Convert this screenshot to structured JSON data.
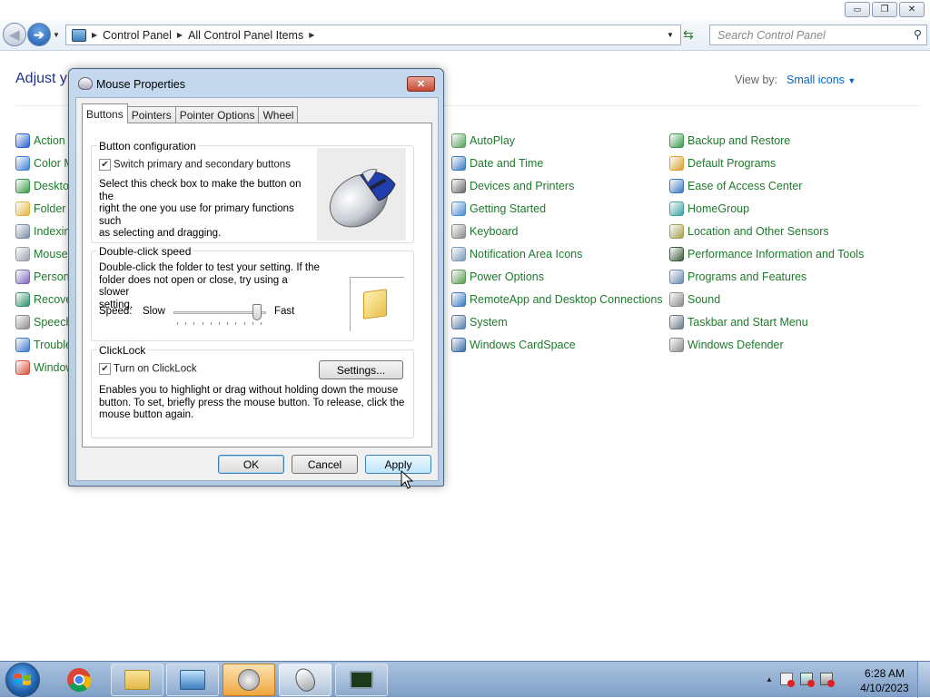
{
  "window": {
    "controls": [
      "▭",
      "❐",
      "✕"
    ]
  },
  "nav": {
    "breadcrumb": [
      "Control Panel",
      "All Control Panel Items"
    ],
    "search_placeholder": "Search Control Panel"
  },
  "header": {
    "title": "Adjust y",
    "view_by_label": "View by:",
    "view_by_value": "Small icons"
  },
  "items": {
    "col1": [
      "Action",
      "Color M",
      "Desktop",
      "Folder C",
      "Indexin",
      "Mouse",
      "Persona",
      "Recove",
      "Speech",
      "Trouble",
      "Window"
    ],
    "col2": [
      "AutoPlay",
      "Date and Time",
      "Devices and Printers",
      "Getting Started",
      "Keyboard",
      "Notification Area Icons",
      "Power Options",
      "RemoteApp and Desktop Connections",
      "System",
      "Windows CardSpace"
    ],
    "col3": [
      "Backup and Restore",
      "Default Programs",
      "Ease of Access Center",
      "HomeGroup",
      "Location and Other Sensors",
      "Performance Information and Tools",
      "Programs and Features",
      "Sound",
      "Taskbar and Start Menu",
      "Windows Defender"
    ],
    "col1_colors": [
      "#2a62c9",
      "#3f7fd4",
      "#3a9a4a",
      "#e0b540",
      "#7a8ca8",
      "#9aa0aa",
      "#7a68b8",
      "#2f8f6a",
      "#8a8a8a",
      "#3f78c8",
      "#d4523c"
    ],
    "col2_colors": [
      "#5aa05a",
      "#3a78c2",
      "#6a6a6a",
      "#4a8ad0",
      "#8a8a8a",
      "#7a9ab8",
      "#5a9a50",
      "#3a78c2",
      "#5a7aa8",
      "#3a6aa8"
    ],
    "col3_colors": [
      "#3a9a4a",
      "#d8a030",
      "#3a78c2",
      "#3aa0a0",
      "#a0a050",
      "#3a5a3a",
      "#6a8ab0",
      "#8a8a8a",
      "#6a7a8a",
      "#8a8a8a"
    ]
  },
  "dialog": {
    "title": "Mouse Properties",
    "close": "✕",
    "tabs": [
      "Buttons",
      "Pointers",
      "Pointer Options",
      "Wheel"
    ],
    "active_tab": "Buttons",
    "button_config": {
      "title": "Button configuration",
      "checkbox_label": "Switch primary and secondary buttons",
      "checked": true,
      "desc_lines": [
        "Select this check box to make the button on the",
        "right the one you use for primary functions such",
        "as selecting and dragging."
      ]
    },
    "double_click": {
      "title": "Double-click speed",
      "desc_lines": [
        "Double-click the folder to test your setting. If the",
        "folder does not open or close, try using a slower",
        "setting."
      ],
      "speed_label": "Speed:",
      "slow": "Slow",
      "fast": "Fast",
      "slider_value": 0.95
    },
    "clicklock": {
      "title": "ClickLock",
      "checkbox_label": "Turn on ClickLock",
      "checked": true,
      "settings_button": "Settings...",
      "desc_lines": [
        "Enables you to highlight or drag without holding down the mouse",
        "button. To set, briefly press the mouse button. To release, click the",
        "mouse button again."
      ]
    },
    "buttons": {
      "ok": "OK",
      "cancel": "Cancel",
      "apply": "Apply"
    }
  },
  "taskbar": {
    "clock_time": "6:28 AM",
    "clock_date": "4/10/2023",
    "tray_arrow": "▲"
  }
}
